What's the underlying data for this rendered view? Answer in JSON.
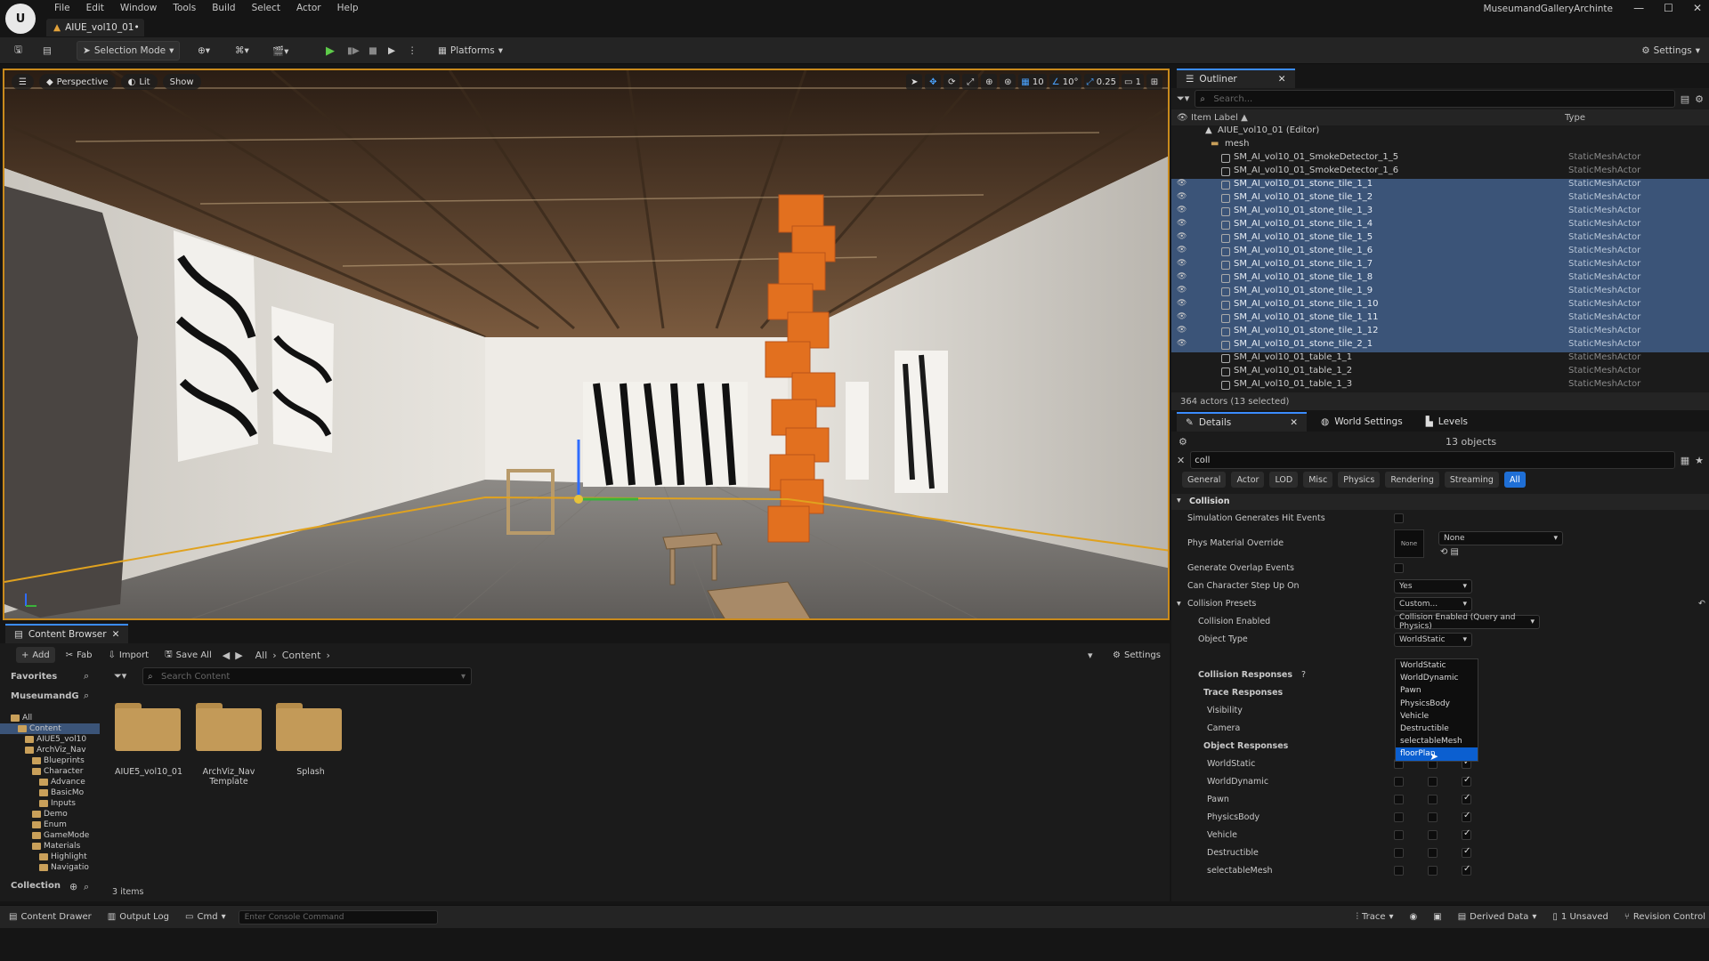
{
  "window": {
    "project_name": "MuseumandGalleryArchinte",
    "doc_tab": "AIUE_vol10_01•",
    "menu": [
      "File",
      "Edit",
      "Window",
      "Tools",
      "Build",
      "Select",
      "Actor",
      "Help"
    ]
  },
  "toolbar": {
    "selection_mode": "Selection Mode",
    "platforms": "Platforms",
    "settings": "Settings"
  },
  "viewport": {
    "perspective": "Perspective",
    "lit": "Lit",
    "show": "Show",
    "grid_snap": "10",
    "rot_snap": "10°",
    "scale_snap": "0.25",
    "camera_speed": "1"
  },
  "outliner": {
    "tab": "Outliner",
    "search_placeholder": "Search...",
    "col_label": "Item Label ▲",
    "col_type": "Type",
    "root": "AIUE_vol10_01 (Editor)",
    "folder": "mesh",
    "rows": [
      {
        "label": "SM_AI_vol10_01_SmokeDetector_1_5",
        "type": "StaticMeshActor",
        "selected": false
      },
      {
        "label": "SM_AI_vol10_01_SmokeDetector_1_6",
        "type": "StaticMeshActor",
        "selected": false
      },
      {
        "label": "SM_AI_vol10_01_stone_tile_1_1",
        "type": "StaticMeshActor",
        "selected": true
      },
      {
        "label": "SM_AI_vol10_01_stone_tile_1_2",
        "type": "StaticMeshActor",
        "selected": true
      },
      {
        "label": "SM_AI_vol10_01_stone_tile_1_3",
        "type": "StaticMeshActor",
        "selected": true
      },
      {
        "label": "SM_AI_vol10_01_stone_tile_1_4",
        "type": "StaticMeshActor",
        "selected": true
      },
      {
        "label": "SM_AI_vol10_01_stone_tile_1_5",
        "type": "StaticMeshActor",
        "selected": true
      },
      {
        "label": "SM_AI_vol10_01_stone_tile_1_6",
        "type": "StaticMeshActor",
        "selected": true
      },
      {
        "label": "SM_AI_vol10_01_stone_tile_1_7",
        "type": "StaticMeshActor",
        "selected": true
      },
      {
        "label": "SM_AI_vol10_01_stone_tile_1_8",
        "type": "StaticMeshActor",
        "selected": true
      },
      {
        "label": "SM_AI_vol10_01_stone_tile_1_9",
        "type": "StaticMeshActor",
        "selected": true
      },
      {
        "label": "SM_AI_vol10_01_stone_tile_1_10",
        "type": "StaticMeshActor",
        "selected": true
      },
      {
        "label": "SM_AI_vol10_01_stone_tile_1_11",
        "type": "StaticMeshActor",
        "selected": true
      },
      {
        "label": "SM_AI_vol10_01_stone_tile_1_12",
        "type": "StaticMeshActor",
        "selected": true
      },
      {
        "label": "SM_AI_vol10_01_stone_tile_2_1",
        "type": "StaticMeshActor",
        "selected": true
      },
      {
        "label": "SM_AI_vol10_01_table_1_1",
        "type": "StaticMeshActor",
        "selected": false
      },
      {
        "label": "SM_AI_vol10_01_table_1_2",
        "type": "StaticMeshActor",
        "selected": false
      },
      {
        "label": "SM_AI_vol10_01_table_1_3",
        "type": "StaticMeshActor",
        "selected": false
      }
    ],
    "footer": "364 actors (13 selected)"
  },
  "details": {
    "tabs": [
      "Details",
      "World Settings",
      "Levels"
    ],
    "objects": "13 objects",
    "search": "coll",
    "categories": [
      "General",
      "Actor",
      "LOD",
      "Misc",
      "Physics",
      "Rendering",
      "Streaming",
      "All"
    ],
    "section": "Collision",
    "props": {
      "sim_hit": "Simulation Generates Hit Events",
      "phys_mat": "Phys Material Override",
      "phys_thumb": "None",
      "phys_combo": "None",
      "overlap": "Generate Overlap Events",
      "step_up": "Can Character Step Up On",
      "step_up_val": "Yes",
      "presets": "Collision Presets",
      "presets_val": "Custom...",
      "enabled": "Collision Enabled",
      "enabled_val": "Collision Enabled (Query and Physics)",
      "object_type": "Object Type",
      "object_type_val": "WorldStatic",
      "responses": "Collision Responses",
      "trace": "Trace Responses",
      "visibility": "Visibility",
      "camera": "Camera",
      "object_resp": "Object Responses"
    },
    "object_rows": [
      "WorldStatic",
      "WorldDynamic",
      "Pawn",
      "PhysicsBody",
      "Vehicle",
      "Destructible",
      "selectableMesh"
    ],
    "dropdown": [
      "WorldStatic",
      "WorldDynamic",
      "Pawn",
      "PhysicsBody",
      "Vehicle",
      "Destructible",
      "selectableMesh",
      "floorPlan"
    ]
  },
  "content_browser": {
    "tab": "Content Browser",
    "add": "Add",
    "fab": "Fab",
    "import": "Import",
    "save_all": "Save All",
    "path": [
      "All",
      "Content"
    ],
    "settings": "Settings",
    "favorites": "Favorites",
    "project": "MuseumandG",
    "search_placeholder": "Search Content",
    "collection": "Collection",
    "count": "3 items",
    "tree": [
      {
        "t": "All",
        "d": 0
      },
      {
        "t": "Content",
        "d": 1
      },
      {
        "t": "AIUE5_vol10",
        "d": 2
      },
      {
        "t": "ArchViz_Nav",
        "d": 2
      },
      {
        "t": "Blueprints",
        "d": 3
      },
      {
        "t": "Character",
        "d": 3
      },
      {
        "t": "Advance",
        "d": 4
      },
      {
        "t": "BasicMo",
        "d": 4
      },
      {
        "t": "Inputs",
        "d": 4
      },
      {
        "t": "Demo",
        "d": 3
      },
      {
        "t": "Enum",
        "d": 3
      },
      {
        "t": "GameMode",
        "d": 3
      },
      {
        "t": "Materials",
        "d": 3
      },
      {
        "t": "Highlight",
        "d": 4
      },
      {
        "t": "Navigatio",
        "d": 4
      }
    ],
    "assets": [
      "AIUE5_vol10_01",
      "ArchViz_Nav Template",
      "Splash"
    ]
  },
  "status": {
    "drawer": "Content Drawer",
    "output": "Output Log",
    "cmd": "Cmd",
    "console_placeholder": "Enter Console Command",
    "trace": "Trace",
    "derived": "Derived Data",
    "unsaved": "1 Unsaved",
    "revision": "Revision Control"
  },
  "colors": {
    "accent": "#3b8cff",
    "selection": "#3b5478",
    "orange": "#e2701f",
    "highlight": "#0b5fd0"
  }
}
